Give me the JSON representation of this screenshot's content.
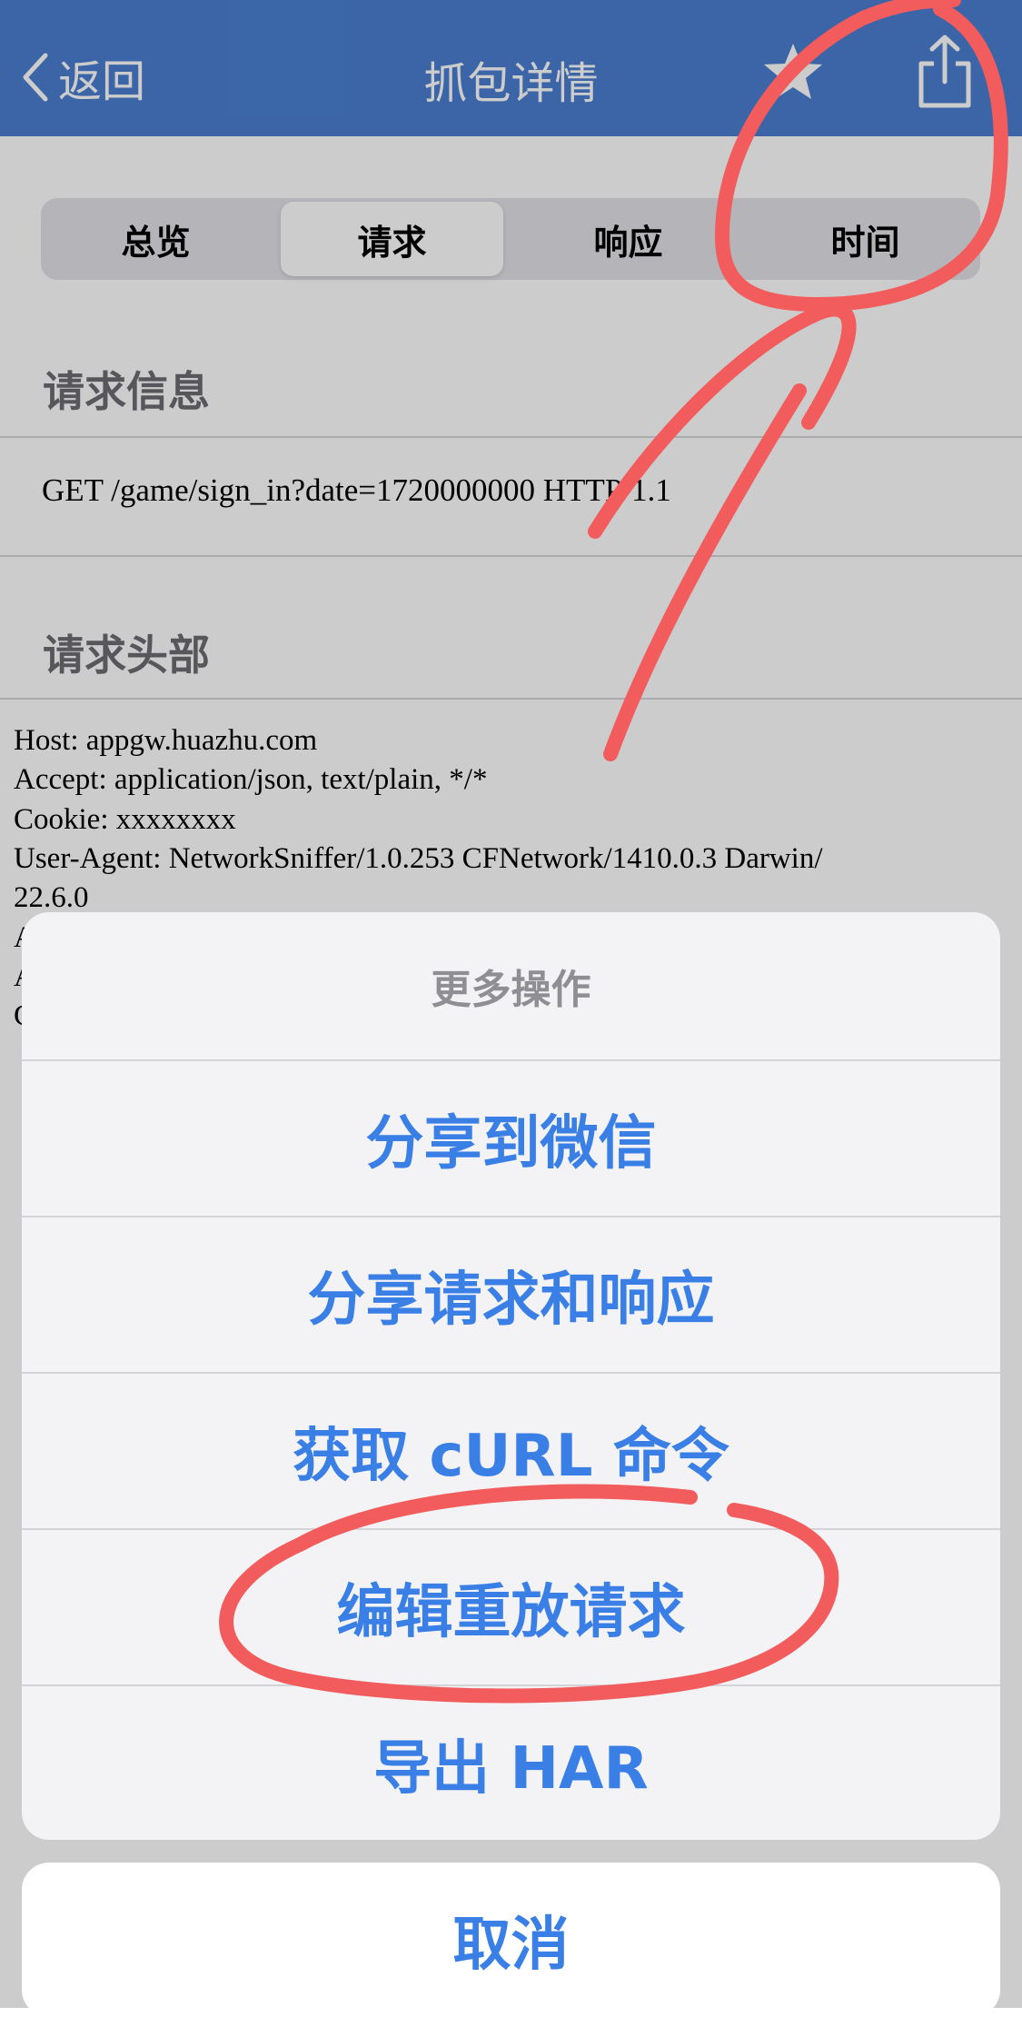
{
  "navbar": {
    "back_label": "返回",
    "title": "抓包详情",
    "favorite_icon": "star-icon",
    "share_icon": "share-icon"
  },
  "tabs": [
    {
      "label": "总览",
      "active": false
    },
    {
      "label": "请求",
      "active": true
    },
    {
      "label": "响应",
      "active": false
    },
    {
      "label": "时间",
      "active": false
    }
  ],
  "request_info": {
    "heading": "请求信息",
    "line": "GET /game/sign_in?date=1720000000 HTTP/1.1"
  },
  "request_headers": {
    "heading": "请求头部",
    "lines": [
      "Host: appgw.huazhu.com",
      "Accept: application/json, text/plain, */*",
      "Cookie: xxxxxxxx",
      "User-Agent: NetworkSniffer/1.0.253 CFNetwork/1410.0.3 Darwin/",
      "22.6.0",
      "A",
      "A",
      "C"
    ]
  },
  "action_sheet": {
    "title": "更多操作",
    "items": [
      "分享到微信",
      "分享请求和响应",
      "获取 cURL 命令",
      "编辑重放请求",
      "导出 HAR"
    ],
    "cancel_label": "取消"
  },
  "colors": {
    "navbar": "#4a7fd1",
    "action_text": "#3a7fe6",
    "annotation": "#f25c5c"
  }
}
